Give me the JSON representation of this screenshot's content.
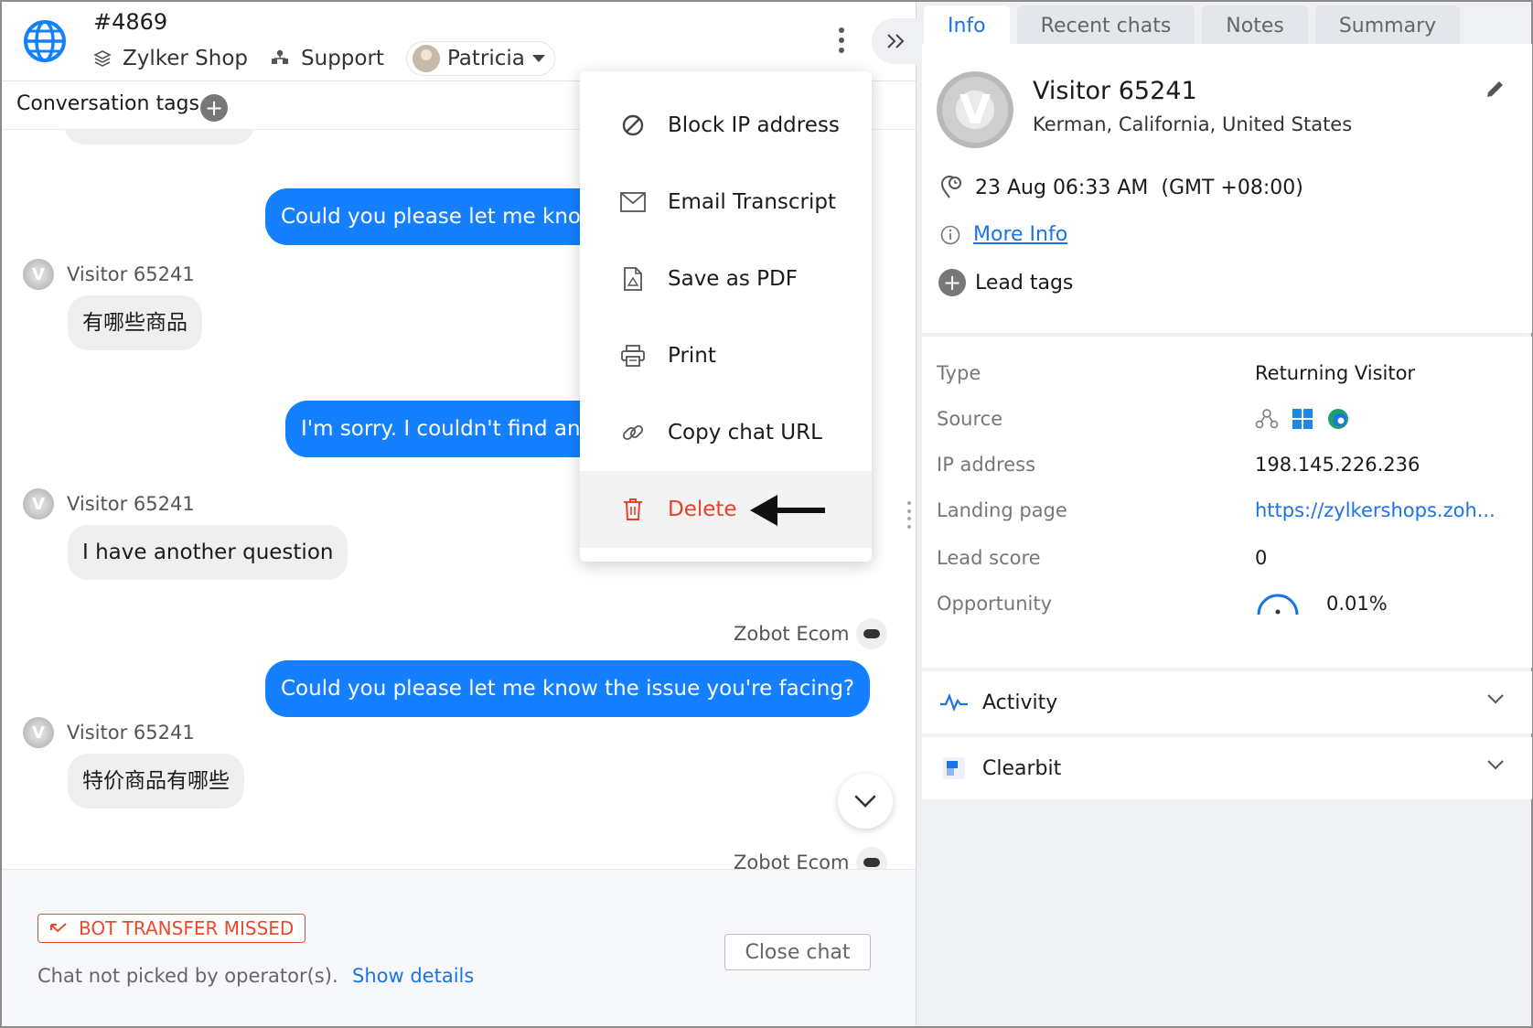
{
  "header": {
    "chat_id": "#4869",
    "department": "Zylker Shop",
    "team": "Support",
    "agent": "Patricia"
  },
  "tags_bar": {
    "label": "Conversation tags"
  },
  "messages": {
    "out_1": "Could you please let me know",
    "visitor_name": "Visitor 65241",
    "in_1": "有哪些商品",
    "out_2": "I'm sorry. I couldn't find any",
    "in_2": "I have another question",
    "bot_name": "Zobot Ecom",
    "out_3": "Could you please let me know the issue you're facing?",
    "in_3": "特价商品有哪些"
  },
  "menu": {
    "items": [
      {
        "label": "Block IP address",
        "icon": "block-icon"
      },
      {
        "label": "Email Transcript",
        "icon": "mail-icon"
      },
      {
        "label": "Save as PDF",
        "icon": "pdf-icon"
      },
      {
        "label": "Print",
        "icon": "printer-icon"
      },
      {
        "label": "Copy chat URL",
        "icon": "link-icon"
      },
      {
        "label": "Delete",
        "icon": "trash-icon"
      }
    ]
  },
  "footer": {
    "badge": "BOT TRANSFER MISSED",
    "status_text": "Chat not picked by operator(s).",
    "show_details": "Show details",
    "close_chat": "Close chat"
  },
  "right_panel": {
    "tabs": [
      "Info",
      "Recent chats",
      "Notes",
      "Summary"
    ],
    "visitor": {
      "name": "Visitor 65241",
      "location": "Kerman, California, United States",
      "time": "23 Aug 06:33 AM",
      "timezone": "(GMT +08:00)",
      "more_info": "More Info",
      "lead_tags": "Lead tags"
    },
    "details": {
      "type_label": "Type",
      "type_value": "Returning Visitor",
      "source_label": "Source",
      "ip_label": "IP address",
      "ip_value": "198.145.226.236",
      "landing_label": "Landing page",
      "landing_value": "https://zylkershops.zoh...",
      "score_label": "Lead score",
      "score_value": "0",
      "opportunity_label": "Opportunity",
      "opportunity_value": "0.01%"
    },
    "sections": [
      "Activity",
      "Clearbit"
    ]
  },
  "colors": {
    "accent": "#1480ff",
    "link": "#1a73e8",
    "danger": "#e5412a",
    "bubble_in": "#efefef"
  }
}
